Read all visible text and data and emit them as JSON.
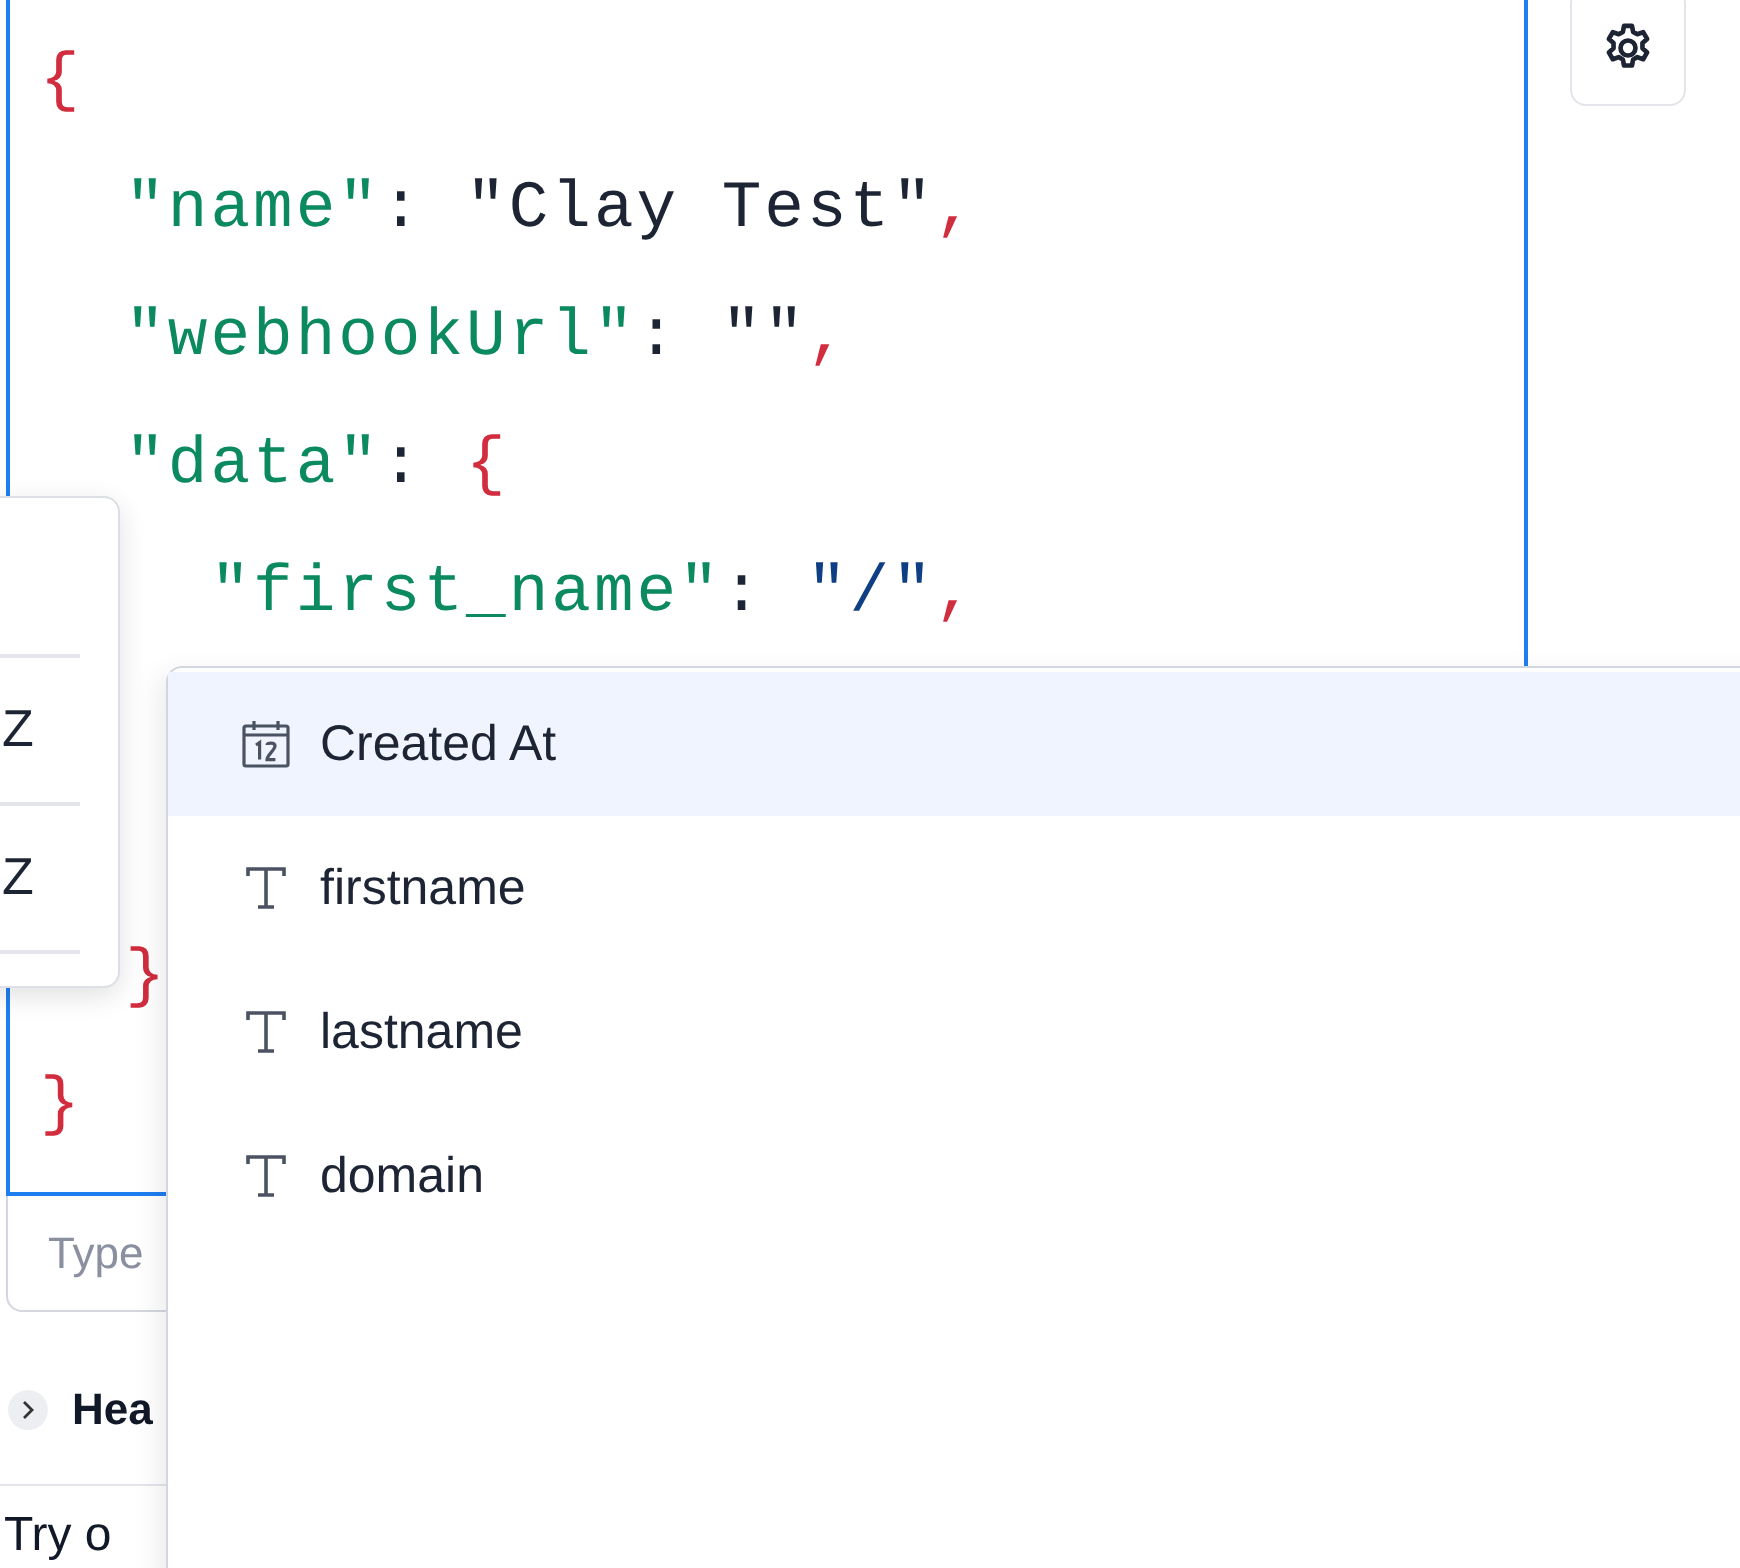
{
  "editor": {
    "lines_top": [
      [
        {
          "kind": "punct",
          "text": "{"
        }
      ],
      [
        {
          "kind": "key",
          "text": "  \"name\""
        },
        {
          "kind": "plain",
          "text": ": "
        },
        {
          "kind": "string",
          "text": "\"Clay Test\""
        },
        {
          "kind": "punct",
          "text": ","
        }
      ],
      [
        {
          "kind": "key",
          "text": "  \"webhookUrl\""
        },
        {
          "kind": "plain",
          "text": ": "
        },
        {
          "kind": "string",
          "text": "\"\""
        },
        {
          "kind": "punct",
          "text": ","
        }
      ],
      [
        {
          "kind": "key",
          "text": "  \"data\""
        },
        {
          "kind": "plain",
          "text": ": "
        },
        {
          "kind": "punct",
          "text": "{"
        }
      ],
      [
        {
          "kind": "key",
          "text": "    \"first_name\""
        },
        {
          "kind": "plain",
          "text": ": "
        },
        {
          "kind": "value",
          "text": "\"/\""
        },
        {
          "kind": "punct",
          "text": ","
        }
      ]
    ],
    "lines_bottom": [
      [
        {
          "kind": "punct",
          "text": "  }"
        }
      ],
      [
        {
          "kind": "punct",
          "text": "}"
        }
      ]
    ]
  },
  "input": {
    "placeholder": "Type"
  },
  "headers_section": {
    "label": "Hea",
    "expanded": false
  },
  "try_section": {
    "label": "Try o"
  },
  "popover": {
    "rows": [
      {
        "text": ""
      },
      {
        "text": "Z"
      },
      {
        "text": "Z"
      }
    ]
  },
  "dropdown": {
    "items": [
      {
        "kind": "date",
        "label": "Created At",
        "selected": true
      },
      {
        "kind": "text",
        "label": "firstname",
        "selected": false
      },
      {
        "kind": "text",
        "label": "lastname",
        "selected": false
      },
      {
        "kind": "text",
        "label": "domain",
        "selected": false
      }
    ]
  }
}
